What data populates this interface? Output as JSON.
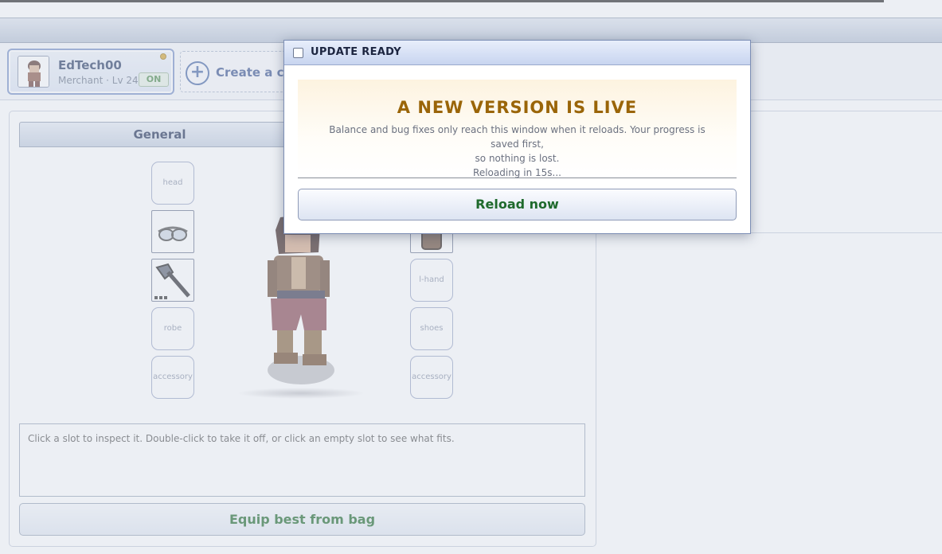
{
  "character": {
    "name": "EdTech00",
    "job": "Merchant",
    "separator": "·",
    "level": "Lv 24",
    "status": "ON"
  },
  "create_character": {
    "label": "Create a cha"
  },
  "tabs": {
    "general": "General"
  },
  "slots": {
    "head": "head",
    "l_hand": "l-hand",
    "robe": "robe",
    "shoes": "shoes",
    "accessory_left": "accessory",
    "accessory_right": "accessory"
  },
  "info_text": "Click a slot to inspect it. Double-click to take it off, or click an empty slot to see what fits.",
  "equip_button": "Equip best from bag",
  "modal": {
    "title": "UPDATE READY",
    "heading": "A NEW VERSION IS LIVE",
    "body_line1": "Balance and bug fixes only reach this window when it reloads. Your progress is saved first,",
    "body_line2": "so nothing is lost.",
    "countdown": "Reloading in 15s...",
    "reload_button": "Reload now"
  },
  "colors": {
    "accent_gold": "#9a6508",
    "action_green": "#1f6a2c",
    "header_blue": "#c8d5f0"
  }
}
